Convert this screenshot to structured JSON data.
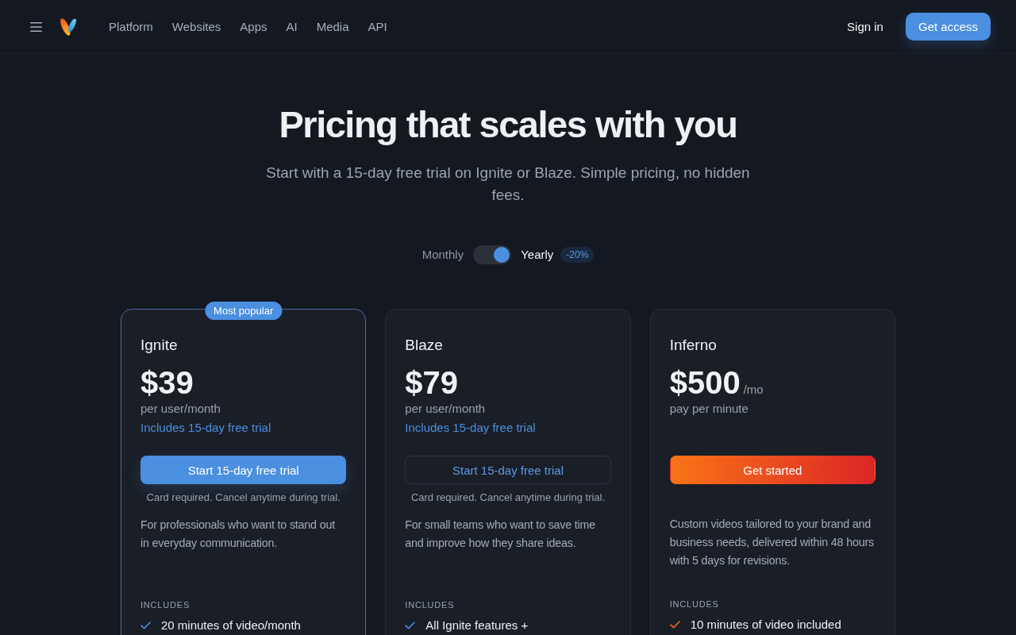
{
  "nav": {
    "links": [
      "Platform",
      "Websites",
      "Apps",
      "AI",
      "Media",
      "API"
    ],
    "sign_in": "Sign in",
    "cta": "Get access"
  },
  "hero": {
    "title": "Pricing that scales with you",
    "subtitle": "Start with a 15-day free trial on Ignite or Blaze. Simple pricing, no hidden fees."
  },
  "billing": {
    "monthly_label": "Monthly",
    "yearly_label": "Yearly",
    "yearly": true,
    "discount": "-20%"
  },
  "plans": [
    {
      "name": "Ignite",
      "badge": "Most popular",
      "highlighted": true,
      "price": "$39",
      "period": "per user/month",
      "trial_note": "Includes 15-day free trial",
      "button": {
        "label": "Start 15-day free trial",
        "kind": "primary"
      },
      "button_note": "Card required. Cancel anytime during trial.",
      "description": "For professionals who want to stand out in everyday communication.",
      "includes_label": "INCLUDES",
      "features": [
        "20 minutes of video/month"
      ]
    },
    {
      "name": "Blaze",
      "highlighted": false,
      "price": "$79",
      "period": "per user/month",
      "trial_note": "Includes 15-day free trial",
      "button": {
        "label": "Start 15-day free trial",
        "kind": "outline"
      },
      "button_note": "Card required. Cancel anytime during trial.",
      "description": "For small teams who want to save time and improve how they share ideas.",
      "includes_label": "INCLUDES",
      "features": [
        "All Ignite features +"
      ]
    },
    {
      "name": "Inferno",
      "highlighted": false,
      "price": "$500",
      "price_suffix": "/mo",
      "period": "pay per minute",
      "button": {
        "label": "Get started",
        "kind": "gradient"
      },
      "description": "Custom videos tailored to your brand and business needs, delivered within 48 hours with 5 days for revisions.",
      "includes_label": "INCLUDES",
      "features": [
        "10 minutes of video included"
      ]
    }
  ]
}
